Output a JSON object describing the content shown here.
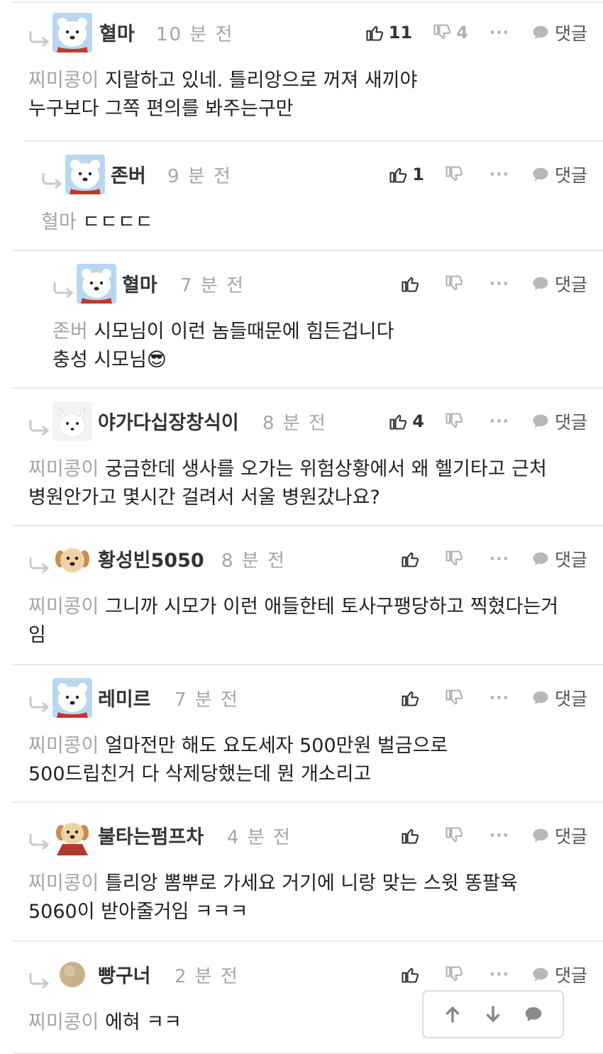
{
  "ui": {
    "reply_label": "댓글",
    "more_label": "···",
    "colors": {
      "text": "#222222",
      "muted": "#a5a5a5",
      "separator": "#e9e9e9",
      "icon": "#333333",
      "icon_muted": "#b0b0b0"
    }
  },
  "comments": [
    {
      "nickname": "혈마",
      "time": "10 분 전",
      "likes": "11",
      "dislikes": "4",
      "mention": "찌미콩이",
      "lines": [
        "지랄하고 있네. 틀리앙으로 꺼져 새끼야",
        "누구보다 그쪽 편의를 봐주는구만"
      ],
      "avatar": "polar-bear"
    },
    {
      "nickname": "존버",
      "time": "9 분 전",
      "likes": "1",
      "dislikes": "",
      "mention": "혈마",
      "lines": [
        "ㄷㄷㄷㄷ",
        ""
      ],
      "avatar": "polar-bear"
    },
    {
      "nickname": "혈마",
      "time": "7 분 전",
      "likes": "",
      "dislikes": "",
      "mention": "존버",
      "lines": [
        "시모님이 이런 놈들때문에 힘든겁니다",
        "충성 시모님😎"
      ],
      "avatar": "polar-bear"
    },
    {
      "nickname": "야가다십장창식이",
      "time": "8 분 전",
      "likes": "4",
      "dislikes": "",
      "mention": "찌미콩이",
      "lines": [
        "궁금한데 생사를 오가는 위험상황에서 왜 헬기타고 근처",
        "병원안가고 몇시간 걸려서 서울 병원갔나요?"
      ],
      "avatar": "white-fox"
    },
    {
      "nickname": "황성빈5050",
      "time": "8 분 전",
      "likes": "",
      "dislikes": "",
      "mention": "찌미콩이",
      "lines": [
        "그니까 시모가 이런 애들한테 토사구팽당하고 찍혔다는거",
        "임"
      ],
      "avatar": "puppy"
    },
    {
      "nickname": "레미르",
      "time": "7 분 전",
      "likes": "",
      "dislikes": "",
      "mention": "찌미콩이",
      "lines": [
        "얼마전만 해도 요도세자 500만원 벌금으로",
        "500드립친거 다 삭제당했는데 뭔 개소리고"
      ],
      "avatar": "polar-bear"
    },
    {
      "nickname": "불타는펌프차",
      "time": "4 분 전",
      "likes": "",
      "dislikes": "",
      "mention": "찌미콩이",
      "lines": [
        "틀리앙 뽐뿌로 가세요 거기에 니랑 맞는 스윗 똥팔육",
        "5060이 받아줄거임 ㅋㅋㅋ"
      ],
      "avatar": "puppy-cape"
    },
    {
      "nickname": "빵구너",
      "time": "2 분 전",
      "likes": "",
      "dislikes": "",
      "mention": "찌미콩이",
      "lines": [
        "에혀 ㅋㅋ",
        ""
      ],
      "avatar": "beige-circle"
    }
  ],
  "floating_bar": {
    "buttons": [
      "arrow-up-icon",
      "arrow-down-icon",
      "chat-bubble-icon"
    ]
  }
}
